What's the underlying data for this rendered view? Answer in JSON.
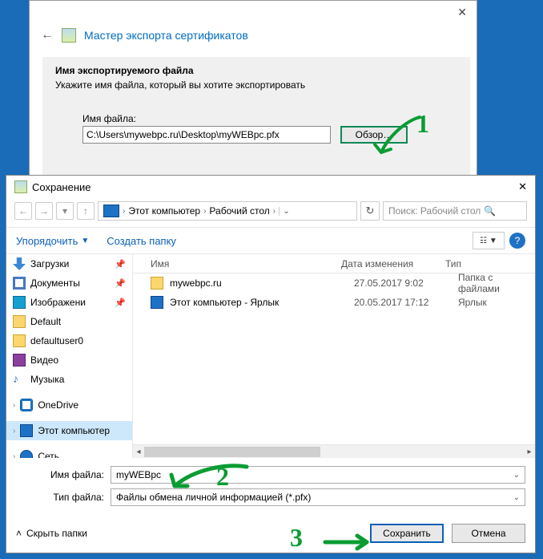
{
  "wizard": {
    "title": "Мастер экспорта сертификатов",
    "section_title": "Имя экспортируемого файла",
    "section_text": "Укажите имя файла, который вы хотите экспортировать",
    "filename_label": "Имя файла:",
    "filename_value": "C:\\Users\\mywebpc.ru\\Desktop\\myWEBpc.pfx",
    "browse_label": "Обзор…"
  },
  "save": {
    "title": "Сохранение",
    "breadcrumb": {
      "seg1": "Этот компьютер",
      "seg2": "Рабочий стол"
    },
    "search_placeholder": "Поиск: Рабочий стол",
    "organize": "Упорядочить",
    "new_folder": "Создать папку",
    "tree": {
      "downloads": "Загрузки",
      "documents": "Документы",
      "pictures": "Изображени",
      "default": "Default",
      "defaultuser0": "defaultuser0",
      "video": "Видео",
      "music": "Музыка",
      "onedrive": "OneDrive",
      "this_pc": "Этот компьютер",
      "network": "Сеть"
    },
    "columns": {
      "name": "Имя",
      "date": "Дата изменения",
      "type": "Тип"
    },
    "rows": [
      {
        "name": "mywebpc.ru",
        "date": "27.05.2017 9:02",
        "type": "Папка с файлами",
        "icon": "fold"
      },
      {
        "name": "Этот компьютер - Ярлык",
        "date": "20.05.2017 17:12",
        "type": "Ярлык",
        "icon": "lnk"
      }
    ],
    "filename_label": "Имя файла:",
    "filename_value": "myWEBpc",
    "filetype_label": "Тип файла:",
    "filetype_value": "Файлы обмена личной информацией (*.pfx)",
    "hide_folders": "Скрыть папки",
    "save_btn": "Сохранить",
    "cancel_btn": "Отмена"
  },
  "annotations": {
    "n1": "1",
    "n2": "2",
    "n3": "3"
  }
}
